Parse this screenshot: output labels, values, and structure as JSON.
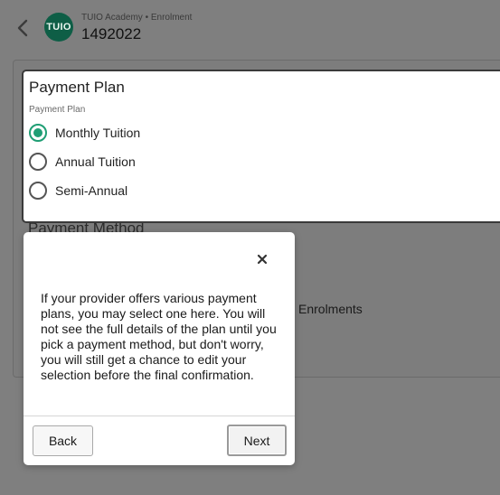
{
  "header": {
    "logo_text": "TUIO",
    "subtitle": "TUIO Academy • Enrolment",
    "enrolment_id": "1492022",
    "back_icon": "chevron-left-icon"
  },
  "background": {
    "payment_method_heading": "Payment Method",
    "enrolments_text": "Enrolments"
  },
  "payment_plan": {
    "title": "Payment Plan",
    "field_label": "Payment Plan",
    "options": [
      {
        "label": "Monthly Tuition",
        "selected": true
      },
      {
        "label": "Annual Tuition",
        "selected": false
      },
      {
        "label": "Semi-Annual",
        "selected": false
      }
    ]
  },
  "popover": {
    "close_icon": "close-icon",
    "text": "If your provider offers various payment plans, you may select one here. You will not see the full details of the plan until you pick a payment method, but don't worry, you will still get a chance to edit your selection before the final confirmation.",
    "back_label": "Back",
    "next_label": "Next"
  },
  "colors": {
    "accent": "#1f9e74",
    "logo_bg": "#0e5e46",
    "overlay": "#7f7f7f"
  }
}
